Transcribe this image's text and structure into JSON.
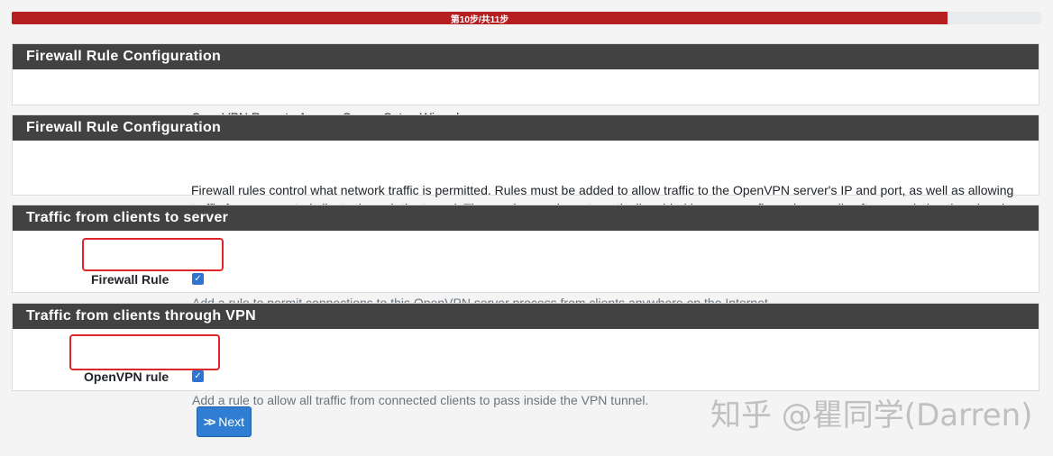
{
  "progress": {
    "label": "第10步/共11步",
    "percent": 90.9
  },
  "panels": [
    {
      "heading": "Firewall Rule Configuration",
      "text": "OpenVPN Remote Access Server Setup Wizard"
    },
    {
      "heading": "Firewall Rule Configuration",
      "text": "Firewall rules control what network traffic is permitted. Rules must be added to allow traffic to the OpenVPN server's IP and port, as well as allowing traffic from connected clients through the tunnel. These rules can be automatically added here, or configured manually after completing the wizard."
    },
    {
      "heading": "Traffic from clients to server",
      "field_label": "Firewall Rule",
      "checked": true,
      "help": "Add a rule to permit connections to this OpenVPN server process from clients anywhere on the Internet."
    },
    {
      "heading": "Traffic from clients through VPN",
      "field_label": "OpenVPN rule",
      "checked": true,
      "help": "Add a rule to allow all traffic from connected clients to pass inside the VPN tunnel."
    }
  ],
  "next_button": {
    "label": "Next",
    "icon": "double-chevron-right-icon"
  },
  "watermark": "知乎 @瞿同学(Darren)",
  "colors": {
    "progress_fill": "#b61e22",
    "panel_heading": "#424242",
    "button": "#2f7ed3",
    "highlight": "#e0262b"
  }
}
